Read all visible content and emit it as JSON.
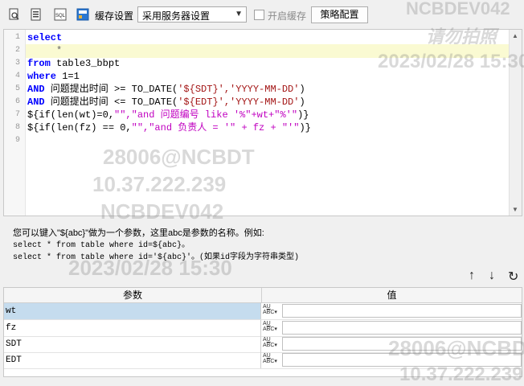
{
  "toolbar": {
    "cache_label": "缓存设置",
    "cache_select_value": "采用服务器设置",
    "enable_cache_label": "开启缓存",
    "strategy_button": "策略配置"
  },
  "editor": {
    "line_numbers": [
      "1",
      "2",
      "3",
      "4",
      "5",
      "6",
      "7",
      "8",
      "9"
    ],
    "lines": {
      "l1_kw": "select",
      "l2_star": "*",
      "l3_kw": "from",
      "l3_tx": " table3_bbpt",
      "l4_kw": "where",
      "l4_tx": " 1=1",
      "l5_kw": "AND",
      "l5_tx": " 问题提出时间 >= TO_DATE(",
      "l5_str": "'${SDT}','YYYY-MM-DD'",
      "l5_end": ")",
      "l6_kw": "AND",
      "l6_tx": " 问题提出时间 <= TO_DATE(",
      "l6_str": "'${EDT}','YYYY-MM-DD'",
      "l6_end": ")",
      "l7_a": "${if(len(wt)=0,",
      "l7_b": "\"\",\"and 问题编号 like '%\"+wt+\"%'\"",
      "l7_c": ")}",
      "l8_a": "${if(len(fz) == 0,",
      "l8_b": "\"\",\"and 负责人 = '\" + fz + \"'\"",
      "l8_c": ")}"
    }
  },
  "help": {
    "line1": "您可以键入\"${abc}\"做为一个参数，这里abc是参数的名称。例如:",
    "line2": "select * from table where id=${abc}。",
    "line3": "select * from table where id='${abc}'。(如果id字段为字符串类型)"
  },
  "grid": {
    "col_param": "参数",
    "col_value": "值",
    "rows": [
      {
        "name": "wt"
      },
      {
        "name": "fz"
      },
      {
        "name": "SDT"
      },
      {
        "name": "EDT"
      }
    ],
    "type_icon_text": "ABC"
  },
  "watermark": {
    "t1": "NCBDEV042",
    "t2": "请勿拍照",
    "t3": "2023/02/28 15:30",
    "t4": "28006@NCBDT",
    "t5": "10.37.222.239"
  }
}
